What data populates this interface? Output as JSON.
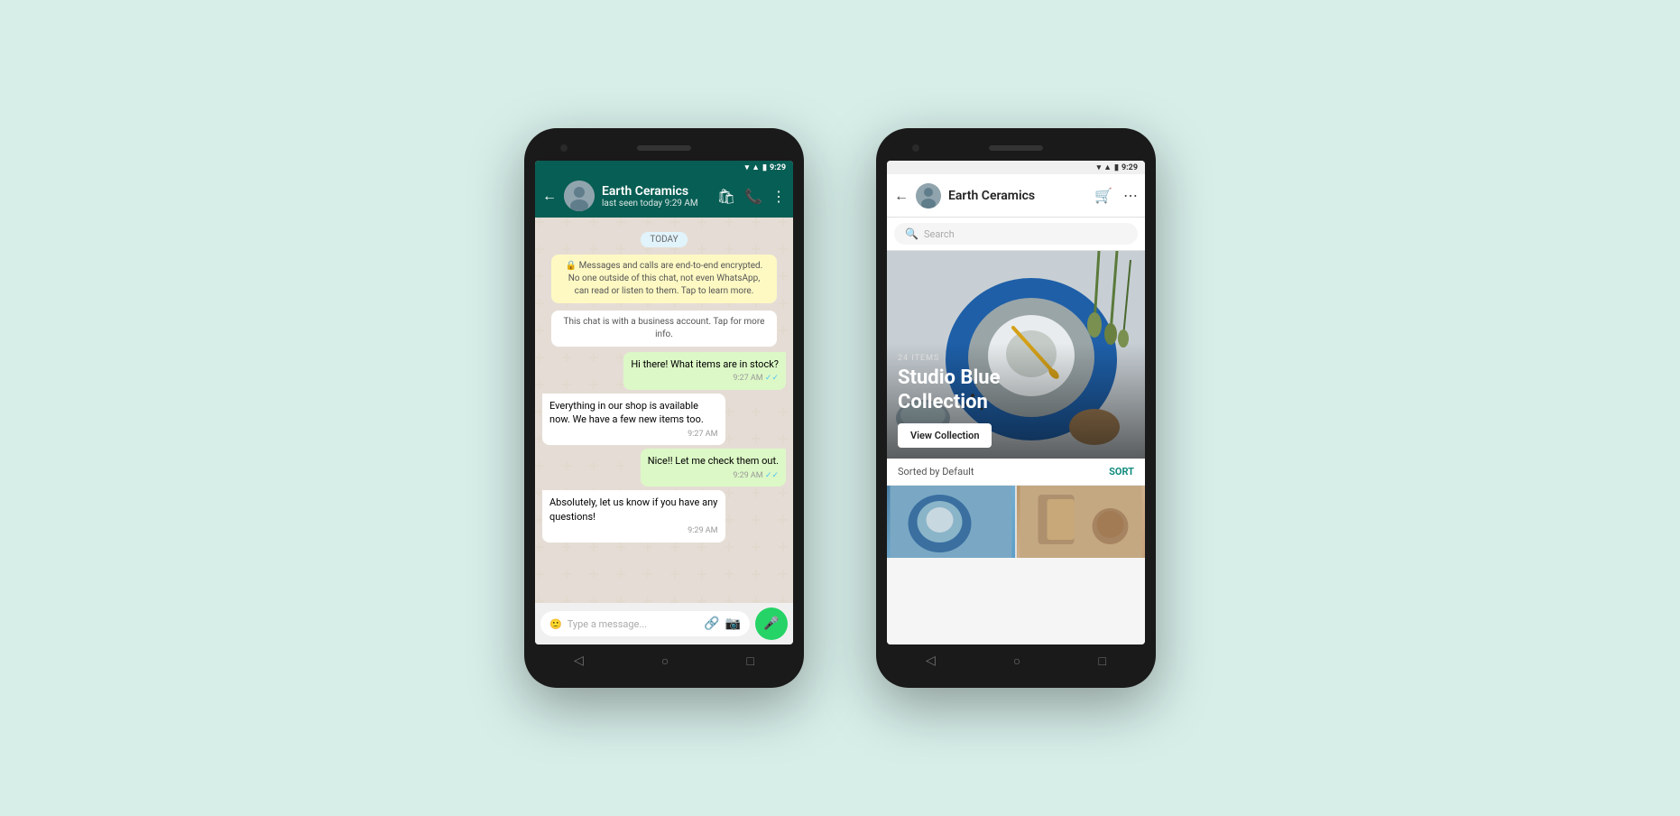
{
  "background_color": "#d6ede8",
  "phone1": {
    "status_bar": {
      "time": "9:29",
      "icons": [
        "wifi",
        "signal",
        "battery"
      ]
    },
    "chat_header": {
      "back_label": "←",
      "contact_name": "Earth Ceramics",
      "status": "last seen today 9:29 AM",
      "actions": [
        "bag",
        "phone",
        "more"
      ]
    },
    "messages": [
      {
        "type": "date",
        "text": "TODAY"
      },
      {
        "type": "system-yellow",
        "text": "🔒 Messages and calls are end-to-end encrypted. No one outside of this chat, not even WhatsApp, can read or listen to them. Tap to learn more."
      },
      {
        "type": "system-white",
        "text": "This chat is with a business account. Tap for more info."
      },
      {
        "type": "sent",
        "text": "Hi there! What items are in stock?",
        "time": "9:27 AM",
        "ticks": true
      },
      {
        "type": "received",
        "text": "Everything in our shop is available now. We have a few new items too.",
        "time": "9:27 AM"
      },
      {
        "type": "sent",
        "text": "Nice!! Let me check them out.",
        "time": "9:29 AM",
        "ticks": true
      },
      {
        "type": "received",
        "text": "Absolutely, let us know if you have any questions!",
        "time": "9:29 AM"
      }
    ],
    "input": {
      "placeholder": "Type a message..."
    }
  },
  "phone2": {
    "status_bar": {
      "time": "9:29",
      "icons": [
        "wifi",
        "signal",
        "battery"
      ]
    },
    "shop_header": {
      "back_label": "←",
      "shop_name": "Earth Ceramics",
      "actions": [
        "cart",
        "more"
      ]
    },
    "search_placeholder": "Search",
    "collection": {
      "item_count": "24 ITEMS",
      "title": "Studio Blue\nCollection",
      "button_label": "View Collection"
    },
    "sort_bar": {
      "label": "Sorted by Default",
      "button": "SORT"
    }
  }
}
